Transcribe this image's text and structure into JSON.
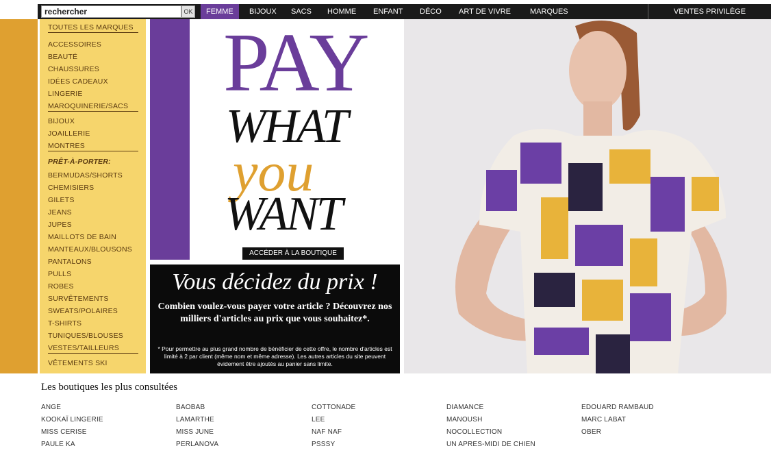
{
  "search": {
    "value": "rechercher",
    "ok_label": "OK"
  },
  "nav": {
    "items": [
      "FEMME",
      "BIJOUX",
      "SACS",
      "HOMME",
      "ENFANT",
      "DÉCO",
      "ART DE VIVRE",
      "MARQUES"
    ],
    "active": "FEMME",
    "ventes_privilege": "VENTES PRIVILÈGE"
  },
  "sidebar": {
    "all_brands": "TOUTES LES MARQUES",
    "items": [
      "ACCESSOIRES",
      "BEAUTÉ",
      "CHAUSSURES",
      "IDÉES CADEAUX",
      "LINGERIE",
      "MAROQUINERIE/SACS",
      "BIJOUX",
      "JOAILLERIE",
      "MONTRES",
      "PRÊT-À-PORTER:",
      "BERMUDAS/SHORTS",
      "CHEMISIERS",
      "GILETS",
      "JEANS",
      "JUPES",
      "MAILLOTS DE BAIN",
      "MANTEAUX/BLOUSONS",
      "PANTALONS",
      "PULLS",
      "ROBES",
      "SURVÊTEMENTS",
      "SWEATS/POLAIRES",
      "T-SHIRTS",
      "TUNIQUES/BLOUSES",
      "VESTES/TAILLEURS",
      "VÊTEMENTS SKI"
    ]
  },
  "hero": {
    "pay": "PAY",
    "what": "WHAT",
    "you": "you",
    "want": "WANT",
    "button": "ACCÉDER À LA BOUTIQUE",
    "title": "Vous décidez du prix !",
    "body": "Combien voulez-vous payer votre article ? Découvrez nos milliers d'articles au prix que vous souhaitez*.",
    "note": "* Pour permettre au plus grand nombre de bénéficier de cette offre, le nombre d'articles est limité à 2 par client (même nom et même adresse). Les autres articles du site peuvent évidement être ajoutés au panier sans limite."
  },
  "popular": {
    "title": "Les boutiques les plus consultées",
    "columns": [
      [
        "ANGE",
        "KOOKAÏ LINGERIE",
        "MISS CERISE",
        "PAULE KA"
      ],
      [
        "BAOBAB",
        "LAMARTHE",
        "MISS JUNE",
        "PERLANOVA"
      ],
      [
        "COTTONADE",
        "LEE",
        "NAF NAF",
        "PSSSY"
      ],
      [
        "DIAMANCE",
        "MANOUSH",
        "NOCOLLECTION",
        "UN APRES-MIDI DE CHIEN"
      ],
      [
        "EDOUARD RAMBAUD",
        "MARC LABAT",
        "OBER"
      ]
    ]
  },
  "colors": {
    "purple": "#6a3d9a",
    "gold": "#dfa030",
    "sidebar": "#f6d56c"
  }
}
